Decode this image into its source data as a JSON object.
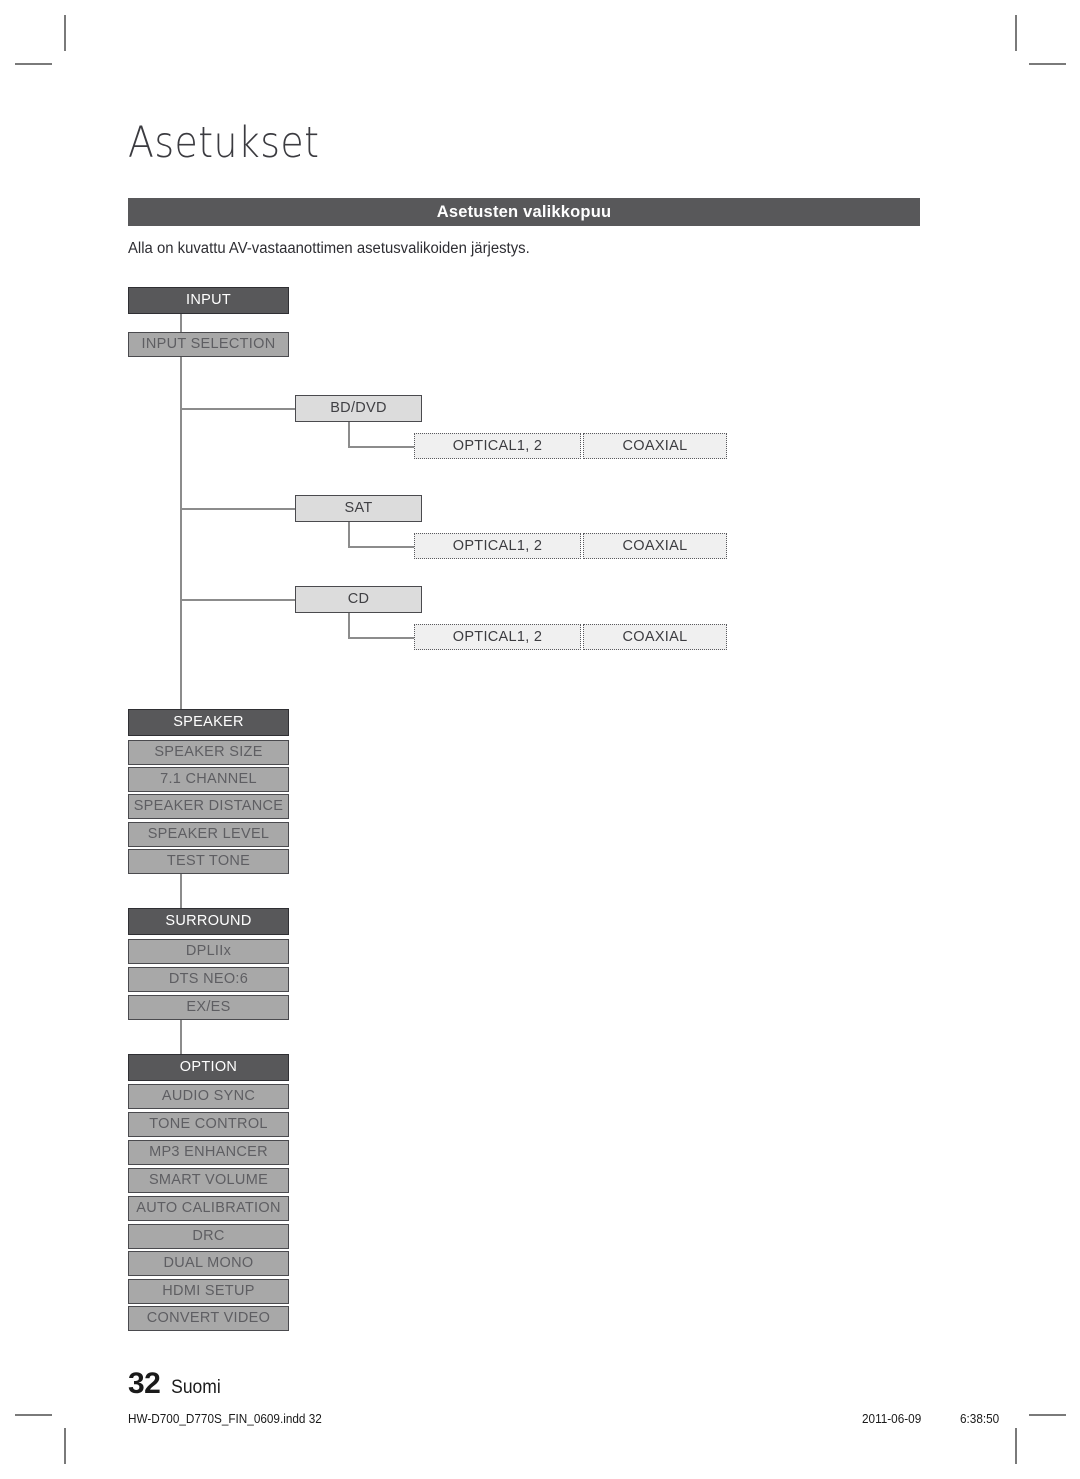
{
  "page": {
    "title": "Asetukset",
    "section_heading": "Asetusten valikkopuu",
    "intro": "Alla on kuvattu AV-vastaanottimen asetusvalikoiden järjestys.",
    "folio_number": "32",
    "folio_language": "Suomi",
    "colors": {
      "band": "#58585a",
      "head_node": "#58585a",
      "sub_node": "#a8a8a8",
      "box_node": "#dcdcdc",
      "dotted_node": "#f0f0f0",
      "line": "#8c8c8c"
    }
  },
  "imprint": {
    "file": "HW-D700_D770S_FIN_0609.indd   32",
    "date": "2011-06-09",
    "time": "6:38:50"
  },
  "tree": {
    "input": {
      "root": "INPUT",
      "selection": "INPUT SELECTION",
      "sources": [
        {
          "label": "BD/DVD",
          "options": [
            "OPTICAL1, 2",
            "COAXIAL"
          ]
        },
        {
          "label": "SAT",
          "options": [
            "OPTICAL1, 2",
            "COAXIAL"
          ]
        },
        {
          "label": "CD",
          "options": [
            "OPTICAL1, 2",
            "COAXIAL"
          ]
        }
      ]
    },
    "speaker": {
      "root": "SPEAKER",
      "items": [
        "SPEAKER SIZE",
        "7.1 CHANNEL",
        "SPEAKER DISTANCE",
        "SPEAKER LEVEL",
        "TEST TONE"
      ]
    },
    "surround": {
      "root": "SURROUND",
      "items": [
        "DPLIIx",
        "DTS NEO:6",
        "EX/ES"
      ]
    },
    "option": {
      "root": "OPTION",
      "items": [
        "AUDIO SYNC",
        "TONE CONTROL",
        "MP3 ENHANCER",
        "SMART VOLUME",
        "AUTO CALIBRATION",
        "DRC",
        "DUAL MONO",
        "HDMI SETUP",
        "CONVERT VIDEO"
      ]
    }
  }
}
